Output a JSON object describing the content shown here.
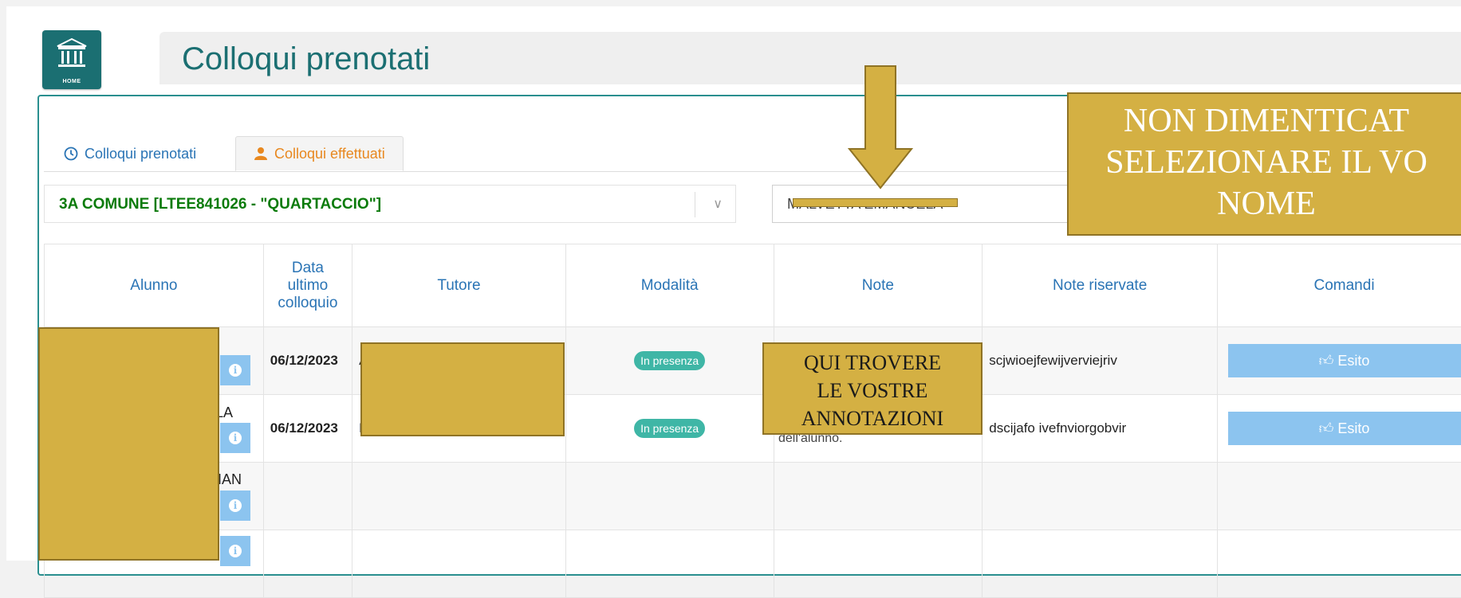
{
  "home": {
    "label": "HOME",
    "icon": "institution-icon"
  },
  "header": {
    "title": "Colloqui prenotati"
  },
  "tabs": [
    {
      "label": "Colloqui prenotati",
      "icon": "clock-icon",
      "active": false
    },
    {
      "label": "Colloqui effettuati",
      "icon": "user-icon",
      "active": true
    }
  ],
  "filters": {
    "class_value": "3A COMUNE [LTEE841026 - \"QUARTACCIO\"]",
    "teacher_value": "MALVETTA EMANUELA"
  },
  "table": {
    "headers": [
      "Alunno",
      "Data ultimo colloquio",
      "Tutore",
      "Modalità",
      "Note",
      "Note riservate",
      "Comandi"
    ],
    "rows": [
      {
        "student_fragment": "",
        "date": "06/12/2023",
        "tutor_fragment": "A",
        "mode": "In presenza",
        "note": "",
        "reserved_note": "scjwioejfewijverviejriv",
        "command": "Esito"
      },
      {
        "student_fragment": "LA",
        "date": "06/12/2023",
        "tutor_fragment": "D",
        "mode": "In presenza",
        "note": "dell'alunno.",
        "reserved_note": "dscijafo ivefnviorgobvir",
        "command": "Esito"
      },
      {
        "student_fragment": "TIAN",
        "date": "",
        "tutor_fragment": "",
        "mode": "",
        "note": "",
        "reserved_note": "",
        "command": ""
      },
      {
        "student_fragment": "",
        "date": "",
        "tutor_fragment": "",
        "mode": "",
        "note": "",
        "reserved_note": "",
        "command": ""
      }
    ]
  },
  "callouts": {
    "top": "NON DIMENTICAT\nSELEZIONARE IL VO\nNOME",
    "mid": "QUI TROVERE\nLE VOSTRE\nANNOTAZIONI"
  },
  "colors": {
    "accent": "#1b6f72",
    "tab_active": "#e8881f",
    "tab_link": "#2a74b5",
    "class_text": "#0b7b0b",
    "pill": "#3fb6a6",
    "button": "#8cc4ef",
    "overlay": "#d4b043"
  }
}
